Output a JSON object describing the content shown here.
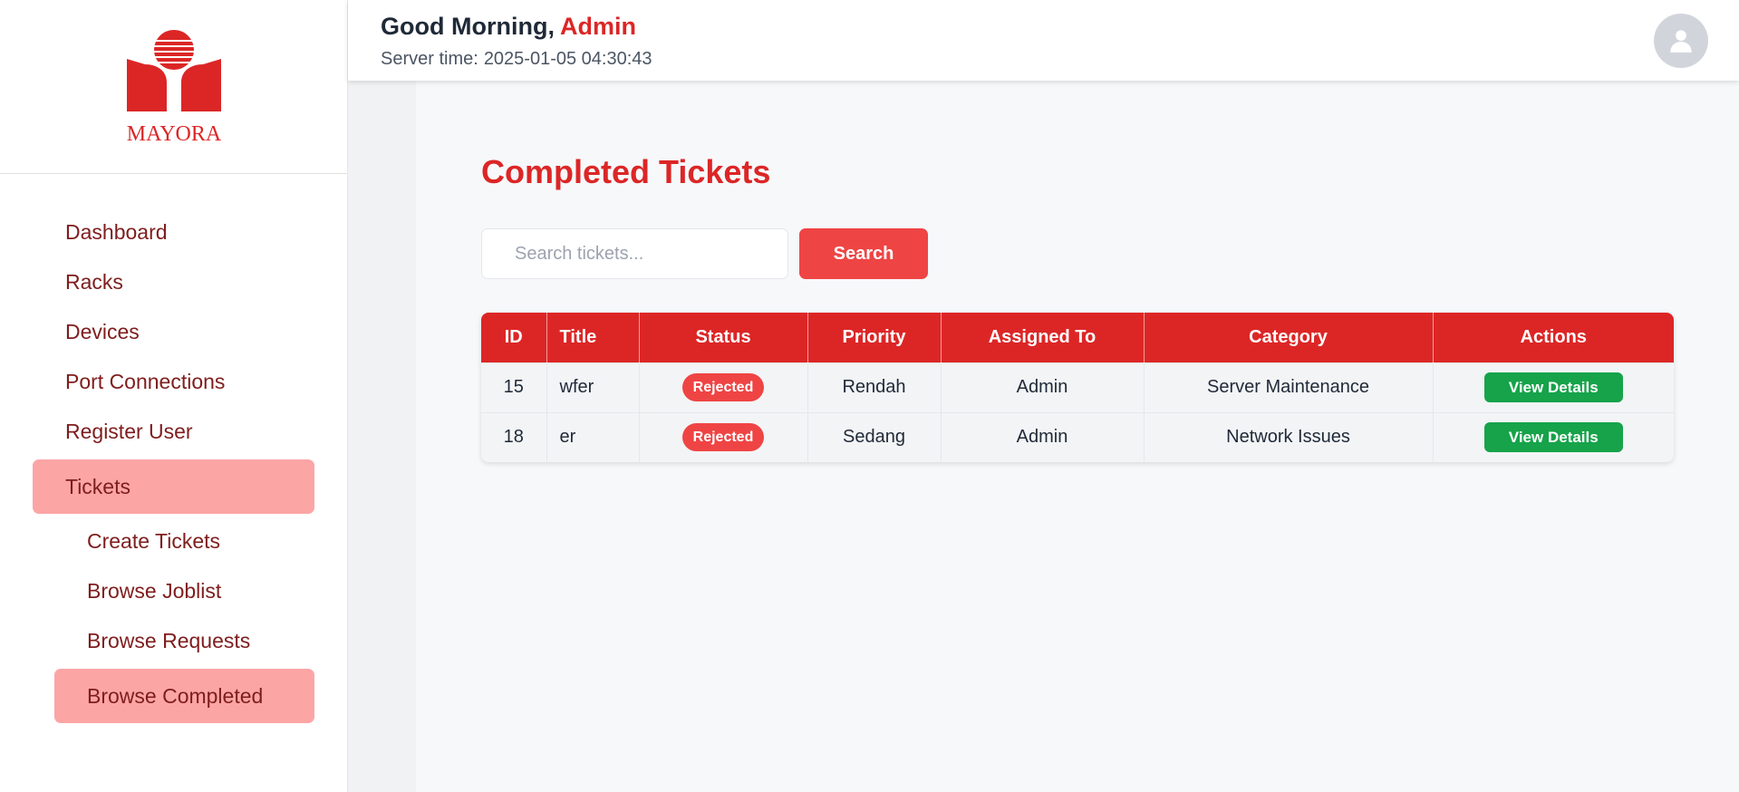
{
  "brand": {
    "name": "MAYORA",
    "color": "#dc2626"
  },
  "header": {
    "greeting": "Good Morning,",
    "user_name": "Admin",
    "server_time_label": "Server time:",
    "server_time_value": "2025-01-05 04:30:43",
    "avatar_icon": "user-icon"
  },
  "sidebar": {
    "items": [
      {
        "label": "Dashboard",
        "active": false,
        "sub": false
      },
      {
        "label": "Racks",
        "active": false,
        "sub": false
      },
      {
        "label": "Devices",
        "active": false,
        "sub": false
      },
      {
        "label": "Port Connections",
        "active": false,
        "sub": false
      },
      {
        "label": "Register User",
        "active": false,
        "sub": false
      },
      {
        "label": "Tickets",
        "active": true,
        "sub": false
      },
      {
        "label": "Create Tickets",
        "active": false,
        "sub": true
      },
      {
        "label": "Browse Joblist",
        "active": false,
        "sub": true
      },
      {
        "label": "Browse Requests",
        "active": false,
        "sub": true
      },
      {
        "label": "Browse Completed",
        "active": true,
        "sub": true
      }
    ]
  },
  "main": {
    "title": "Completed Tickets",
    "search": {
      "placeholder": "Search tickets...",
      "value": "",
      "button_label": "Search"
    },
    "table": {
      "columns": [
        "ID",
        "Title",
        "Status",
        "Priority",
        "Assigned To",
        "Category",
        "Actions"
      ],
      "rows": [
        {
          "id": "15",
          "title": "wfer",
          "status": "Rejected",
          "priority": "Rendah",
          "assigned_to": "Admin",
          "category": "Server Maintenance",
          "action_label": "View Details"
        },
        {
          "id": "18",
          "title": "er",
          "status": "Rejected",
          "priority": "Sedang",
          "assigned_to": "Admin",
          "category": "Network Issues",
          "action_label": "View Details"
        }
      ]
    }
  },
  "colors": {
    "accent": "#dc2626",
    "nav_active": "#fca5a5",
    "badge_rejected": "#ef4444",
    "action_button": "#16a34a"
  }
}
